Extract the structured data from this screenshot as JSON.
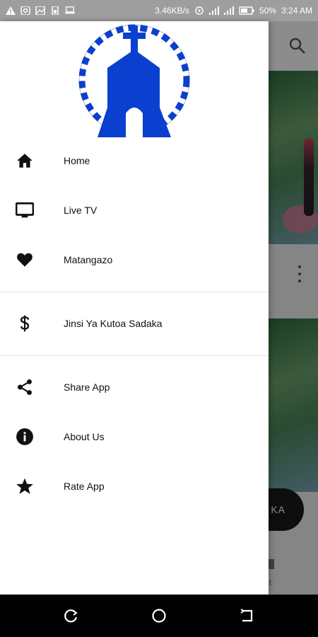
{
  "status_bar": {
    "speed": "3.46KB/s",
    "battery": "50%",
    "time": "3:24 AM"
  },
  "drawer": {
    "items": [
      {
        "label": "Home",
        "icon": "home-icon"
      },
      {
        "label": "Live TV",
        "icon": "tv-icon"
      },
      {
        "label": "Matangazo",
        "icon": "heart-icon"
      },
      {
        "label": "Jinsi Ya Kutoa Sadaka",
        "icon": "dollar-icon"
      },
      {
        "label": "Share App",
        "icon": "share-icon"
      },
      {
        "label": "About Us",
        "icon": "info-icon"
      },
      {
        "label": "Rate App",
        "icon": "star-icon"
      }
    ]
  },
  "background": {
    "fab_label": "KA",
    "tab_label": "ist"
  },
  "colors": {
    "logo_blue": "#0b3fd0",
    "drawer_bg": "#ffffff",
    "text": "#111111"
  }
}
